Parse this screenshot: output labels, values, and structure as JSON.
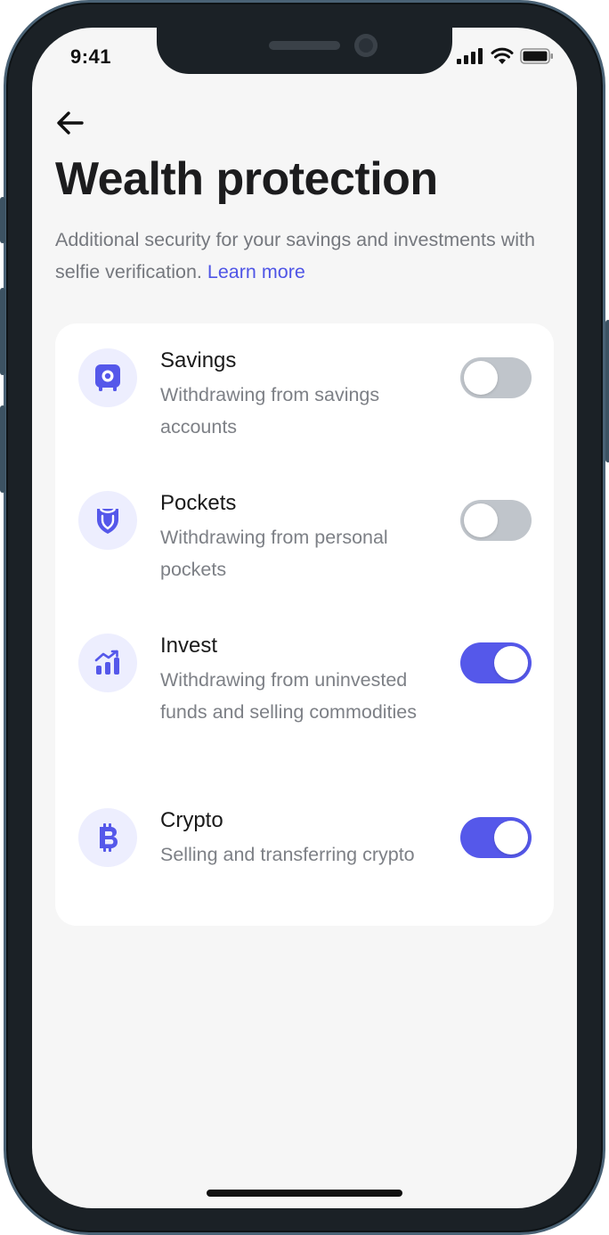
{
  "status_bar": {
    "time": "9:41"
  },
  "header": {
    "back_icon": "arrow-left-icon",
    "title": "Wealth protection",
    "subtitle": "Additional security for your savings and investments with selfie verification.",
    "learn_more": "Learn more"
  },
  "settings": [
    {
      "title": "Savings",
      "description": "Withdrawing from savings accounts",
      "icon": "safe-icon",
      "enabled": false
    },
    {
      "title": "Pockets",
      "description": "Withdrawing from personal pockets",
      "icon": "pocket-icon",
      "enabled": false
    },
    {
      "title": "Invest",
      "description": "Withdrawing from uninvested funds and selling commodities",
      "icon": "chart-icon",
      "enabled": true
    },
    {
      "title": "Crypto",
      "description": "Selling and transferring crypto",
      "icon": "bitcoin-icon",
      "enabled": true
    }
  ],
  "colors": {
    "accent": "#5558ea",
    "toggle_off": "#c0c5cb",
    "icon_bg": "#edeefe",
    "background": "#f6f6f6"
  }
}
